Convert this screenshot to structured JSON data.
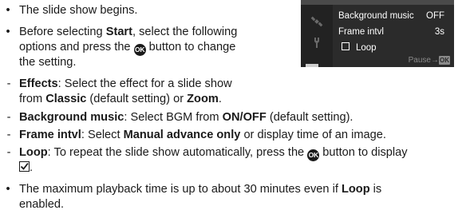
{
  "screen": {
    "rows": [
      {
        "label": "Background music",
        "value": "OFF"
      },
      {
        "label": "Frame intvl",
        "value": "3s"
      },
      {
        "label": "Loop",
        "value": ""
      }
    ],
    "pause_label": "Pause→",
    "pause_key": "OK",
    "sidebar_icons": [
      "satellite-icon",
      "wrench-icon"
    ]
  },
  "ok_symbol": "OK",
  "content": {
    "b1": "The slide show begins.",
    "b2_a": "Before selecting ",
    "b2_start": "Start",
    "b2_b": ", select the following",
    "b2_line2_a": "options and press the ",
    "b2_line2_b": " button to change",
    "b2_line3": "the setting.",
    "effects_label": "Effects",
    "effects_a": ": Select the effect for a slide show",
    "effects_line2_a": "from ",
    "effects_classic": "Classic",
    "effects_line2_b": " (default setting) or ",
    "effects_zoom": "Zoom",
    "effects_line2_c": ".",
    "bgm_label": "Background music",
    "bgm_a": ": Select BGM from ",
    "bgm_onoff": "ON/OFF",
    "bgm_b": " (default setting).",
    "frame_label": "Frame intvl",
    "frame_a": ": Select ",
    "frame_manual": "Manual advance only",
    "frame_b": " or display time of an image.",
    "loop_label": "Loop",
    "loop_a": ": To repeat the slide show automatically, press the ",
    "loop_b": " button to display",
    "loop_line2": ".",
    "b3_a": "The maximum playback time is up to about 30 minutes even if ",
    "b3_loop": "Loop",
    "b3_b": " is",
    "b3_line2": "enabled."
  }
}
